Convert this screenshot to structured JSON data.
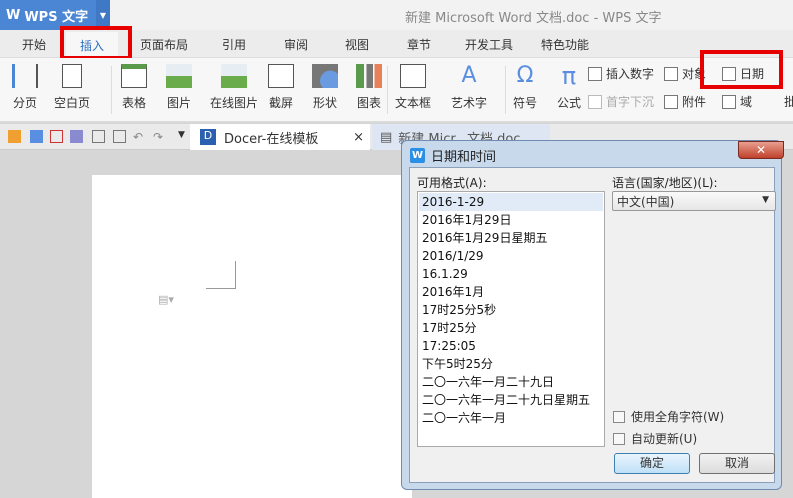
{
  "app": {
    "name": "WPS 文字",
    "window_title": "新建 Microsoft Word 文档.doc - WPS 文字"
  },
  "tabs": [
    "开始",
    "插入",
    "页面布局",
    "引用",
    "审阅",
    "视图",
    "章节",
    "开发工具",
    "特色功能"
  ],
  "active_tab": "插入",
  "ribbon": {
    "large": [
      "分页",
      "空白页",
      "表格",
      "图片",
      "在线图片",
      "截屏",
      "形状",
      "图表",
      "文本框",
      "艺术字",
      "符号",
      "公式"
    ],
    "small": {
      "insert_number": "插入数字",
      "object": "对象",
      "date": "日期",
      "drop_cap": "首字下沉",
      "attachment": "附件",
      "field": "域"
    },
    "cut_off": "批"
  },
  "doc_tabs": [
    {
      "label": "Docer-在线模板"
    },
    {
      "label": "新建 Micr...文档.doc"
    }
  ],
  "dialog": {
    "title": "日期和时间",
    "formats_label": "可用格式(A):",
    "formats": [
      "2016-1-29",
      "2016年1月29日",
      "2016年1月29日星期五",
      "2016/1/29",
      "16.1.29",
      "2016年1月",
      "17时25分5秒",
      "17时25分",
      "17:25:05",
      "下午5时25分",
      "二〇一六年一月二十九日",
      "二〇一六年一月二十九日星期五",
      "二〇一六年一月"
    ],
    "selected_index": 0,
    "language_label": "语言(国家/地区)(L):",
    "language_value": "中文(中国)",
    "fullwidth_label": "使用全角字符(W)",
    "autoupdate_label": "自动更新(U)",
    "ok": "确定",
    "cancel": "取消"
  },
  "colors": {
    "accent": "#4a86d4",
    "highlight": "#e60000"
  }
}
